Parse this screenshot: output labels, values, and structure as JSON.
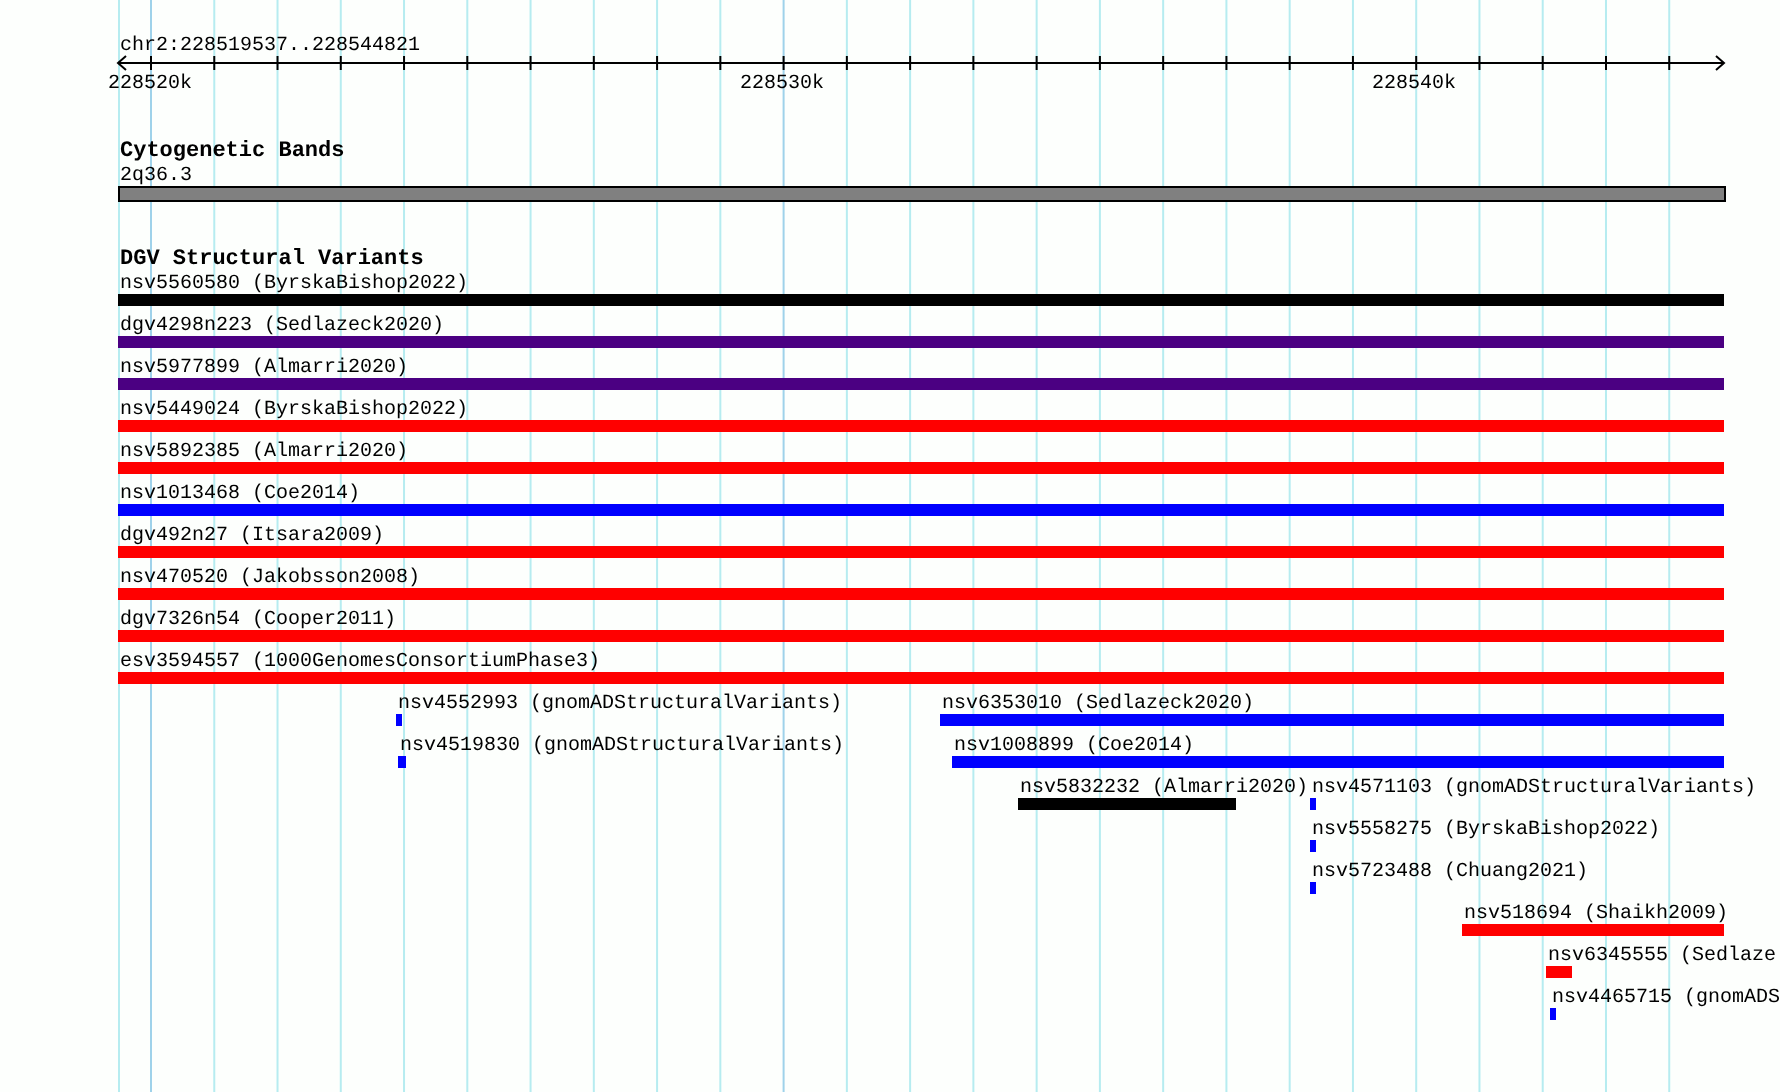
{
  "location": "chr2:228519537..228544821",
  "ruler": {
    "ticks": [
      "228520k",
      "228530k",
      "228540k"
    ]
  },
  "tracks": [
    {
      "title": "Cytogenetic Bands",
      "kind": "band",
      "features": [
        {
          "label": "2q36.3",
          "color": "#808080"
        }
      ]
    },
    {
      "title": "DGV Structural Variants",
      "kind": "variant",
      "features": [
        {
          "label": "nsv5560580 (ByrskaBishop2022)",
          "color": "#000000"
        },
        {
          "label": "dgv4298n223 (Sedlazeck2020)",
          "color": "#4b0082"
        },
        {
          "label": "nsv5977899 (Almarri2020)",
          "color": "#4b0082"
        },
        {
          "label": "nsv5449024 (ByrskaBishop2022)",
          "color": "#ff0000"
        },
        {
          "label": "nsv5892385 (Almarri2020)",
          "color": "#ff0000"
        },
        {
          "label": "nsv1013468 (Coe2014)",
          "color": "#0000ff"
        },
        {
          "label": "dgv492n27 (Itsara2009)",
          "color": "#ff0000"
        },
        {
          "label": "nsv470520 (Jakobsson2008)",
          "color": "#ff0000"
        },
        {
          "label": "dgv7326n54 (Cooper2011)",
          "color": "#ff0000"
        },
        {
          "label": "esv3594557 (1000GenomesConsortiumPhase3)",
          "color": "#ff0000"
        },
        {
          "label": "nsv4552993 (gnomADStructuralVariants)",
          "color": "#0000ff"
        },
        {
          "label": "nsv6353010 (Sedlazeck2020)",
          "color": "#0000ff"
        },
        {
          "label": "nsv4519830 (gnomADStructuralVariants)",
          "color": "#0000ff"
        },
        {
          "label": "nsv1008899 (Coe2014)",
          "color": "#0000ff"
        },
        {
          "label": "nsv5832232 (Almarri2020)",
          "color": "#000000"
        },
        {
          "label": "nsv4571103 (gnomADStructuralVariants)",
          "color": "#0000ff"
        },
        {
          "label": "nsv5558275 (ByrskaBishop2022)",
          "color": "#0000ff"
        },
        {
          "label": "nsv5723488 (Chuang2021)",
          "color": "#0000ff"
        },
        {
          "label": "nsv518694 (Shaikh2009)",
          "color": "#ff0000"
        },
        {
          "label": "nsv6345555 (Sedlaze",
          "color": "#ff0000"
        },
        {
          "label": "nsv4465715 (gnomADS",
          "color": "#0000ff"
        }
      ]
    }
  ]
}
